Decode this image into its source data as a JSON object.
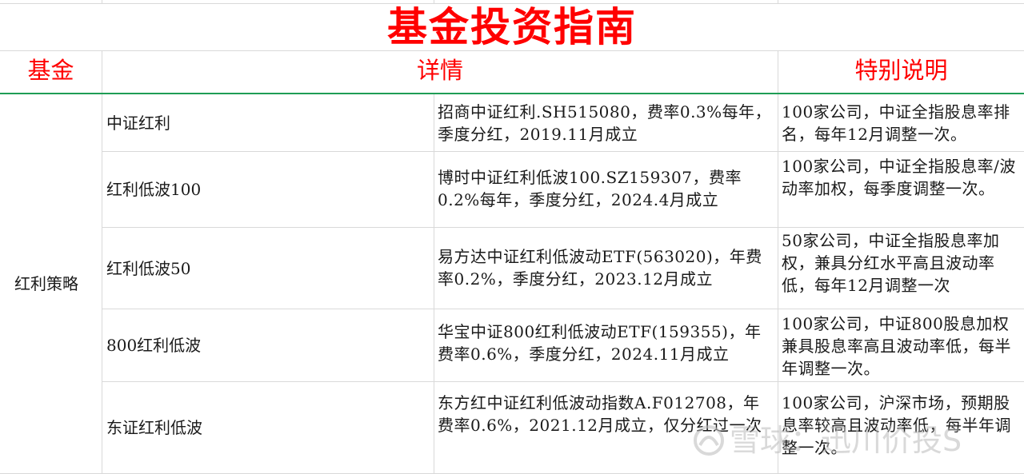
{
  "title": "基金投资指南",
  "headers": {
    "fund": "基金",
    "detail": "详情",
    "note": "特别说明"
  },
  "category": "红利策略",
  "rows": [
    {
      "name": "中证红利",
      "detail": "招商中证红利.SH515080，费率0.3%每年，季度分红，2019.11月成立",
      "note": "100家公司，中证全指股息率排名，每年12月调整一次。"
    },
    {
      "name": "红利低波100",
      "detail": "博时中证红利低波100.SZ159307，费率0.2%每年，季度分红，2024.4月成立",
      "note": "100家公司，中证全指股息率/波动率加权，每季度调整一次。"
    },
    {
      "name": "红利低波50",
      "detail": "易方达中证红利低波动ETF(563020)，年费率0.2%，季度分红，2023.12月成立",
      "note": "50家公司，中证全指股息率加权，兼具分红水平高且波动率低，每年12月调整一次"
    },
    {
      "name": "800红利低波",
      "detail": "华宝中证800红利低波动ETF(159355)，年费率0.6%，季度分红，2024.11月成立",
      "note": "100家公司，中证800股息加权兼具股息率高且波动率低，每半年调整一次。"
    },
    {
      "name": "东证红利低波",
      "detail": "东方红中证红利低波动指数A.F012708，年费率0.6%，2021.12月成立，仅分红过一次",
      "note": "100家公司，沪深市场，预期股息率较高且波动率低，每半年调整一次。"
    }
  ],
  "watermark": {
    "text": "雪球：迅川价投S",
    "icon": "snowball-icon"
  },
  "colors": {
    "title": "#ff0000",
    "header_rule": "#1f9d55",
    "grid": "#d9d9d9"
  }
}
